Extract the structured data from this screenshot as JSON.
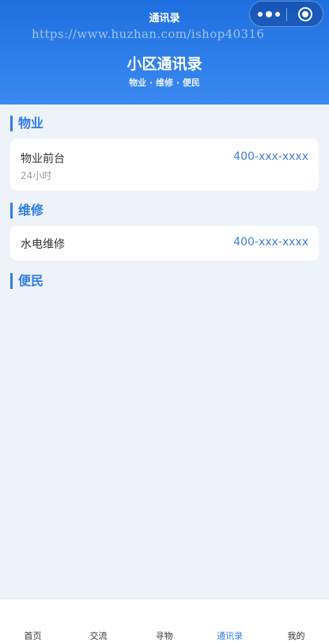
{
  "nav": {
    "title": "通讯录",
    "watermark": "https://www.huzhan.com/ishop40316",
    "more_icon": "more-dots-icon",
    "close_icon": "target-circle-icon"
  },
  "hero": {
    "title": "小区通讯录",
    "subtitle": "物业 · 维修 · 便民"
  },
  "sections": [
    {
      "title": "物业",
      "items": [
        {
          "name": "物业前台",
          "phone": "400-xxx-xxxx",
          "hours": "24小时"
        }
      ]
    },
    {
      "title": "维修",
      "items": [
        {
          "name": "水电维修",
          "phone": "400-xxx-xxxx"
        }
      ]
    },
    {
      "title": "便民",
      "items": []
    }
  ],
  "tabbar": {
    "tabs": [
      "首页",
      "交流",
      "寻物",
      "通讯录",
      "我的"
    ],
    "active": "通讯录"
  },
  "colors": {
    "header_start": "#1e6fe0",
    "header_end": "#3b8af0",
    "accent": "#2f7de6",
    "background": "#eef3f9"
  }
}
